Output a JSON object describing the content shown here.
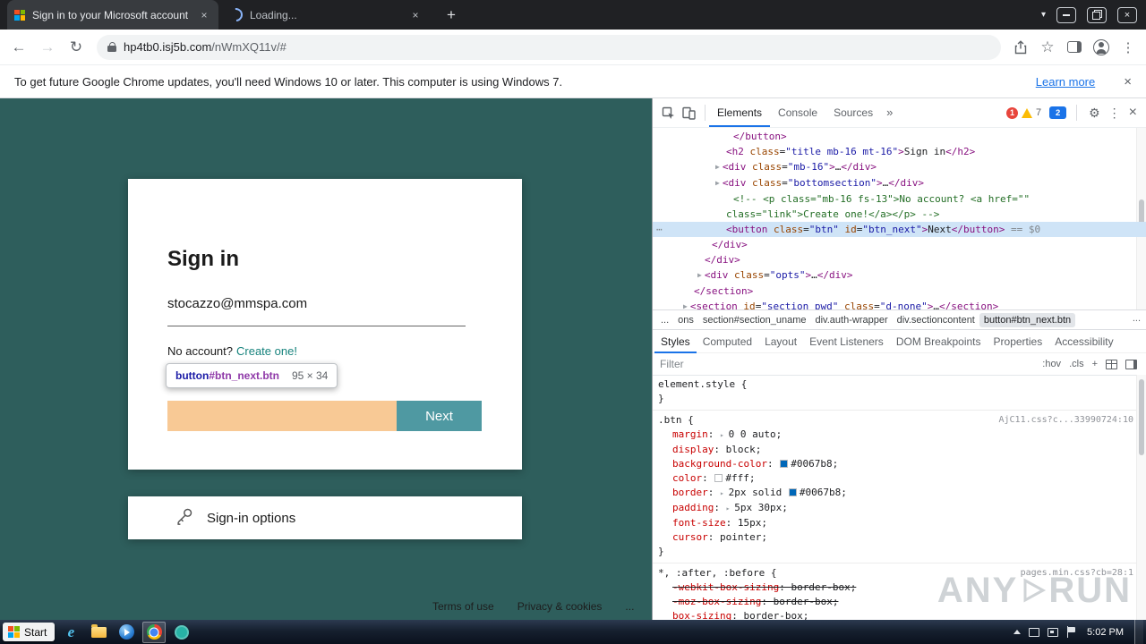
{
  "browser": {
    "tabs": [
      {
        "title": "Sign in to your Microsoft account"
      },
      {
        "title": "Loading..."
      }
    ],
    "url": {
      "domain": "hp4tb0.isj5b.com",
      "path": "/nWmXQ11v/#"
    },
    "infobar": {
      "message": "To get future Google Chrome updates, you'll need Windows 10 or later. This computer is using Windows 7.",
      "link": "Learn more"
    }
  },
  "page": {
    "card": {
      "title": "Sign in",
      "email": "stocazzo@mmspa.com",
      "no_account": "No account?",
      "create_link": "Create one!",
      "next_button": "Next"
    },
    "tooltip": {
      "tag": "button",
      "rest": "#btn_next.btn",
      "dims": "95 × 34"
    },
    "signin_options": "Sign-in options",
    "footer": [
      "Terms of use",
      "Privacy & cookies",
      "..."
    ]
  },
  "devtools": {
    "tabs": [
      "Elements",
      "Console",
      "Sources"
    ],
    "more_tabs": "»",
    "badges": {
      "errors": "1",
      "warnings": "7",
      "issues": "2"
    },
    "dom": [
      {
        "indent": 90,
        "segs": [
          [
            "t",
            "</button>"
          ]
        ]
      },
      {
        "indent": 82,
        "segs": [
          [
            "t",
            "<h2"
          ],
          [
            "a",
            " class"
          ],
          [
            "x",
            "="
          ],
          [
            "v",
            "\"title mb-16 mt-16\""
          ],
          [
            "t",
            ">"
          ],
          [
            "x",
            "Sign in"
          ],
          [
            "t",
            "</h2>"
          ]
        ]
      },
      {
        "indent": 70,
        "arrow": true,
        "segs": [
          [
            "t",
            "<div"
          ],
          [
            "a",
            " class"
          ],
          [
            "x",
            "="
          ],
          [
            "v",
            "\"mb-16\""
          ],
          [
            "t",
            ">"
          ],
          [
            "x",
            "…"
          ],
          [
            "t",
            "</div>"
          ]
        ]
      },
      {
        "indent": 70,
        "arrow": true,
        "segs": [
          [
            "t",
            "<div"
          ],
          [
            "a",
            " class"
          ],
          [
            "x",
            "="
          ],
          [
            "v",
            "\"bottomsection\""
          ],
          [
            "t",
            ">"
          ],
          [
            "x",
            "…"
          ],
          [
            "t",
            "</div>"
          ]
        ]
      },
      {
        "indent": 90,
        "segs": [
          [
            "c",
            "<!-- <p class=\"mb-16 fs-13\">No account? <a href=\"\""
          ]
        ]
      },
      {
        "indent": 82,
        "segs": [
          [
            "c",
            "class=\"link\">Create one!</a></p> -->"
          ]
        ]
      },
      {
        "indent": 82,
        "selected": true,
        "gutter": true,
        "segs": [
          [
            "t",
            "<button"
          ],
          [
            "a",
            " class"
          ],
          [
            "x",
            "="
          ],
          [
            "v",
            "\"btn\""
          ],
          [
            "a",
            " id"
          ],
          [
            "x",
            "="
          ],
          [
            "v",
            "\"btn_next\""
          ],
          [
            "t",
            ">"
          ],
          [
            "x",
            "Next"
          ],
          [
            "t",
            "</button>"
          ],
          [
            "g",
            " == $0"
          ]
        ]
      },
      {
        "indent": 66,
        "segs": [
          [
            "t",
            "</div>"
          ]
        ]
      },
      {
        "indent": 58,
        "segs": [
          [
            "t",
            "</div>"
          ]
        ]
      },
      {
        "indent": 50,
        "arrow": true,
        "segs": [
          [
            "t",
            "<div"
          ],
          [
            "a",
            " class"
          ],
          [
            "x",
            "="
          ],
          [
            "v",
            "\"opts\""
          ],
          [
            "t",
            ">"
          ],
          [
            "x",
            "…"
          ],
          [
            "t",
            "</div>"
          ]
        ]
      },
      {
        "indent": 46,
        "segs": [
          [
            "t",
            "</section>"
          ]
        ]
      },
      {
        "indent": 34,
        "arrow": true,
        "segs": [
          [
            "t",
            "<section"
          ],
          [
            "a",
            " id"
          ],
          [
            "x",
            "="
          ],
          [
            "v",
            "\"section_pwd\""
          ],
          [
            "a",
            " class"
          ],
          [
            "x",
            "="
          ],
          [
            "v",
            "\"d-none\""
          ],
          [
            "t",
            ">"
          ],
          [
            "x",
            "…"
          ],
          [
            "t",
            "</section>"
          ]
        ]
      }
    ],
    "breadcrumbs": [
      "...",
      "ons",
      "section#section_uname",
      "div.auth-wrapper",
      "div.sectioncontent",
      "button#btn_next.btn"
    ],
    "crumbs_overflow": "...",
    "styles_tabs": [
      "Styles",
      "Computed",
      "Layout",
      "Event Listeners",
      "DOM Breakpoints",
      "Properties",
      "Accessibility"
    ],
    "filter_placeholder": "Filter",
    "pseudo_toggles": [
      ":hov",
      ".cls",
      "+"
    ],
    "rules": [
      {
        "selector": "element.style",
        "source": "",
        "props": []
      },
      {
        "selector": ".btn",
        "source": "AjC11.css?c...33990724:10",
        "props": [
          {
            "name": "margin",
            "arrow": true,
            "segs": [
              {
                "t": "0 0 auto"
              }
            ]
          },
          {
            "name": "display",
            "segs": [
              {
                "t": "block"
              }
            ]
          },
          {
            "name": "background-color",
            "segs": [
              {
                "s": "#0067b8"
              },
              {
                "t": "#0067b8"
              }
            ]
          },
          {
            "name": "color",
            "segs": [
              {
                "s": "#ffffff"
              },
              {
                "t": "#fff"
              }
            ]
          },
          {
            "name": "border",
            "arrow": true,
            "segs": [
              {
                "t": "2px solid "
              },
              {
                "s": "#0067b8"
              },
              {
                "t": "#0067b8"
              }
            ]
          },
          {
            "name": "padding",
            "arrow": true,
            "segs": [
              {
                "t": "5px 30px"
              }
            ]
          },
          {
            "name": "font-size",
            "segs": [
              {
                "t": "15px"
              }
            ]
          },
          {
            "name": "cursor",
            "segs": [
              {
                "t": "pointer"
              }
            ]
          }
        ]
      },
      {
        "selector": "*, :after, :before",
        "source": "pages.min.css?cb=28:1",
        "props": [
          {
            "name": "-webkit-box-sizing",
            "struck": true,
            "segs": [
              {
                "t": "border-box"
              }
            ]
          },
          {
            "name": "-moz-box-sizing",
            "struck": true,
            "segs": [
              {
                "t": "border-box"
              }
            ]
          },
          {
            "name": "box-sizing",
            "segs": [
              {
                "t": "border-box"
              }
            ]
          }
        ]
      }
    ],
    "watermark": {
      "left": "ANY",
      "right": "RUN"
    }
  },
  "taskbar": {
    "start_label": "Start",
    "time": "5:02 PM"
  }
}
